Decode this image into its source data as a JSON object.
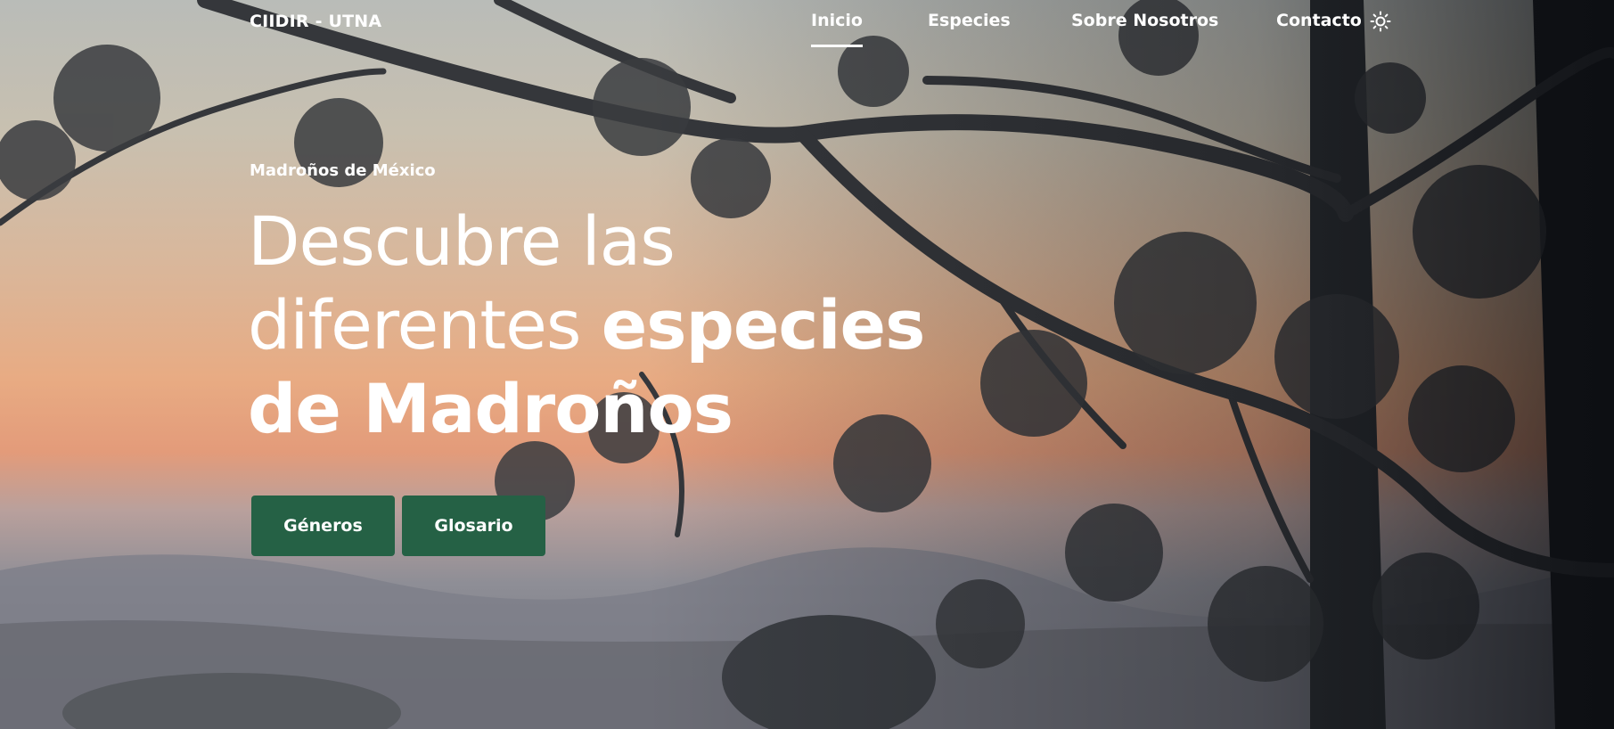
{
  "brand": "CIIDIR - UTNA",
  "nav": {
    "items": [
      {
        "label": "Inicio",
        "active": true
      },
      {
        "label": "Especies",
        "active": false
      },
      {
        "label": "Sobre Nosotros",
        "active": false
      },
      {
        "label": "Contacto",
        "active": false
      }
    ],
    "theme_icon": "sun-icon"
  },
  "hero": {
    "eyebrow": "Madroños de México",
    "headline": {
      "part1": "Descubre las",
      "part2": "diferentes ",
      "part3": "especies",
      "part4": "de ",
      "part5": "Madroños"
    },
    "buttons": [
      {
        "label": "Géneros"
      },
      {
        "label": "Glosario"
      }
    ]
  },
  "colors": {
    "button_bg": "#256145",
    "text": "#ffffff",
    "sky_top": "#b9bcb8",
    "sky_glow": "#e8ab83",
    "mountains": "#8e8e96"
  }
}
